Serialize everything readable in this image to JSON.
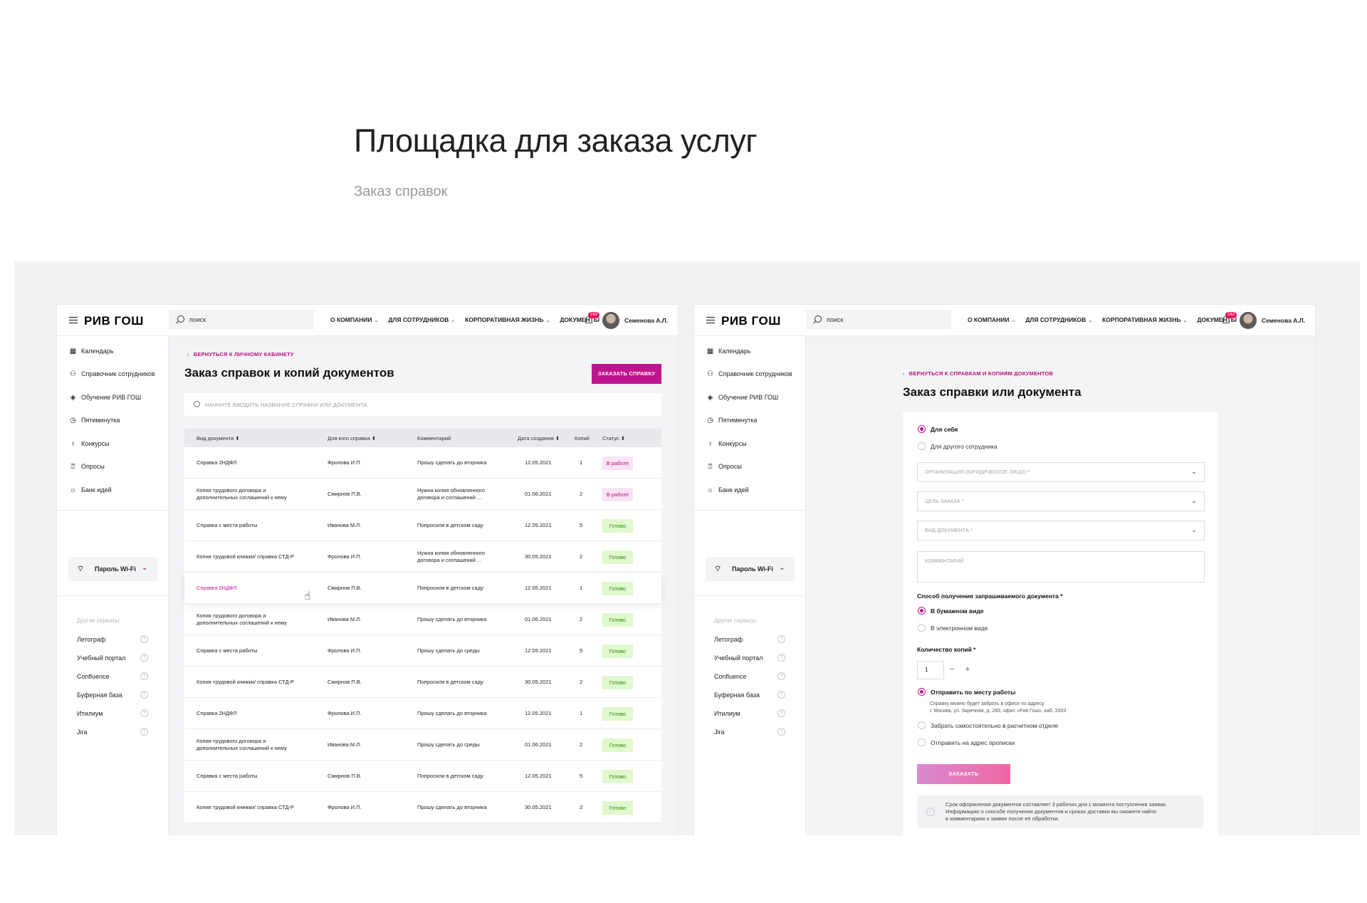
{
  "hero": {
    "title": "Площадка для заказа услуг",
    "subtitle": "Заказ справок"
  },
  "header": {
    "logo": "РИВ ГОШ",
    "search_placeholder": "поиск",
    "nav": [
      "О КОМПАНИИ",
      "ДЛЯ СОТРУДНИКОВ",
      "КОРПОРАТИВНАЯ ЖИЗНЬ",
      "ДОКУМЕНТЫ"
    ],
    "nav_has_dropdown": [
      true,
      true,
      true,
      false
    ],
    "notifications": "243",
    "left_user": "Семенова А.Л.",
    "right_user": "Семенова А.Л."
  },
  "sidebar": {
    "items": [
      {
        "label": "Календарь",
        "icon": "calendar-icon"
      },
      {
        "label": "Справочник сотрудников",
        "icon": "people-icon"
      },
      {
        "label": "Обучение РИВ ГОШ",
        "icon": "graduation-cap-icon"
      },
      {
        "label": "Пятиминутка",
        "icon": "alarm-clock-icon"
      },
      {
        "label": "Конкурсы",
        "icon": "medal-icon"
      },
      {
        "label": "Опросы",
        "icon": "question-square-icon"
      },
      {
        "label": "Банк идей",
        "icon": "lightbulb-icon"
      }
    ],
    "wifi_label": "Пароль Wi-Fi",
    "other_title": "Другие сервисы",
    "other_items": [
      "Летограф",
      "Учебный портал",
      "Confluence",
      "Буферная база",
      "Итилиум",
      "Jira"
    ]
  },
  "list_page": {
    "back_link": "ВЕРНУТЬСЯ К ЛИЧНОМУ КАБИНЕТУ",
    "title": "Заказ справок и копий документов",
    "order_button": "ЗАКАЗАТЬ СПРАВКУ",
    "search_placeholder": "НАЧНИТЕ ВВОДИТЬ НАЗВАНИЕ СПРАВКИ ИЛИ ДОКУМЕНТА",
    "columns": [
      "Вид документа ⬍",
      "Для кого справка ⬍",
      "Комментарий",
      "Дата создания ⬍",
      "Копий",
      "Статус ⬍"
    ],
    "rows": [
      {
        "doc": "Справка 2НДФЛ",
        "who": "Фролова И.П.",
        "comment": "Прошу сделать до вторника",
        "date": "12.05.2021",
        "copies": "1",
        "status": "В работе",
        "kind": "work"
      },
      {
        "doc": "Копия трудового договора и дополнительных соглашений к нему",
        "who": "Смирнов П.В.",
        "comment": "Нужна копия обновленного договора и соглашений ...",
        "date": "01.06.2021",
        "copies": "2",
        "status": "В работе",
        "kind": "work"
      },
      {
        "doc": "Справка с места работы",
        "who": "Иванова М.Л.",
        "comment": "Попросили в детском саду",
        "date": "12.05.2021",
        "copies": "5",
        "status": "Готово",
        "kind": "done"
      },
      {
        "doc": "Копия трудовой книжки/ справка СТД-Р",
        "who": "Фролова И.П.",
        "comment": "Нужна копия обновленного договора и соглашений ...",
        "date": "30.05.2021",
        "copies": "2",
        "status": "Готово",
        "kind": "done"
      },
      {
        "doc": "Справка 2НДФЛ",
        "who": "Смирнов П.В.",
        "comment": "Попросили в детском саду",
        "date": "12.05.2021",
        "copies": "1",
        "status": "Готово",
        "kind": "done"
      },
      {
        "doc": "Копия трудового договора и дополнительных соглашений к нему",
        "who": "Иванова М.Л.",
        "comment": "Прошу сделать до вторника",
        "date": "01.06.2021",
        "copies": "2",
        "status": "Готово",
        "kind": "done"
      },
      {
        "doc": "Справка с места работы",
        "who": "Фролова И.П.",
        "comment": "Прошу сделать до среды",
        "date": "12.05.2021",
        "copies": "5",
        "status": "Готово",
        "kind": "done"
      },
      {
        "doc": "Копия трудовой книжки/ справка СТД-Р",
        "who": "Смирнов П.В.",
        "comment": "Попросили в детском саду",
        "date": "30.05.2021",
        "copies": "2",
        "status": "Готово",
        "kind": "done"
      },
      {
        "doc": "Справка 2НДФЛ",
        "who": "Фролова И.П.",
        "comment": "Прошу сделать до вторника",
        "date": "12.05.2021",
        "copies": "1",
        "status": "Готово",
        "kind": "done"
      },
      {
        "doc": "Копия трудового договора и дополнительных соглашений к нему",
        "who": "Иванова М.Л.",
        "comment": "Прошу сделать до среды",
        "date": "01.06.2021",
        "copies": "2",
        "status": "Готово",
        "kind": "done"
      },
      {
        "doc": "Справка с места работы",
        "who": "Смирнов П.В.",
        "comment": "Попросили в детском саду",
        "date": "12.05.2021",
        "copies": "5",
        "status": "Готово",
        "kind": "done"
      },
      {
        "doc": "Копия трудовой книжки/ справка СТД-Р",
        "who": "Фролова И.П.",
        "comment": "Прошу сделать до вторника",
        "date": "30.05.2021",
        "copies": "2",
        "status": "Готово",
        "kind": "done"
      }
    ]
  },
  "form_page": {
    "back_link": "ВЕРНУТЬСЯ К СПРАВКАМ И КОПИЯМ ДОКУМЕНТОВ",
    "title": "Заказ справки или документа",
    "for_self": "Для себя",
    "for_other": "Для другого сотрудника",
    "organization": "ОРГАНИЗАЦИЯ (ЮРИДИЧЕСКОЕ ЛИЦО) *",
    "purpose": "ЦЕЛЬ ЗАКАЗА *",
    "doc_type": "ВИД ДОКУМЕНТА *",
    "comment": "КОММЕНТАРИЙ",
    "method_label": "Способ получения запрашиваемого документа *",
    "paper": "В бумажном виде",
    "electronic": "В электронном виде",
    "copies_label": "Количество копий *",
    "copies_value": "1",
    "minus": "−",
    "plus": "+",
    "send_work": "Отправить по месту работы",
    "send_work_note_1": "Справку можно будет забрать в офисе по адресу",
    "send_work_note_2": "г. Москва, ул. Заречная, д. 283, офис «Рив Гош», каб. 2003",
    "pickup": "Забрать самостоятельно в расчетном отделе",
    "send_home": "Отправить на адрес прописки",
    "submit": "ЗАКАЗАТЬ",
    "info_1": "Срок оформления документов составляет 3 рабочих дня с момента поступления заявки.",
    "info_2": "Информацию о способе получения документов и сроках доставки вы сможете найти",
    "info_3": "в комментариях к заявке после её обработки."
  },
  "colors": {
    "accent": "#c0148f",
    "status_work_bg": "#fbe3f3",
    "status_done_bg": "#dff8cc",
    "badge": "#e8145a"
  }
}
